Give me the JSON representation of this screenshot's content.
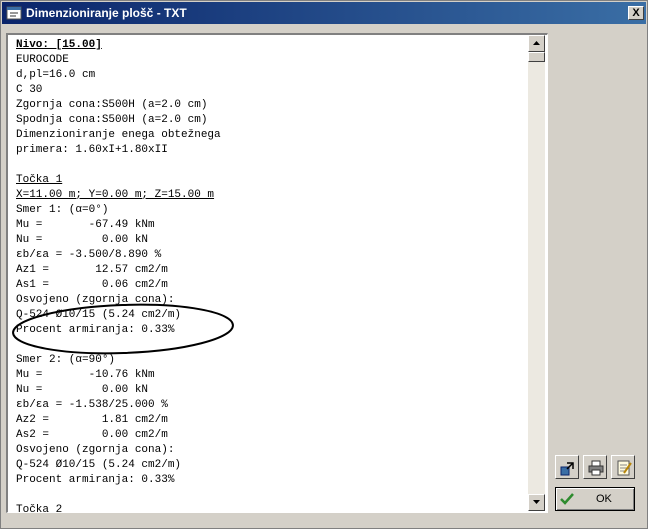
{
  "window": {
    "title": "Dimenzioniranje plošč - TXT",
    "close_label": "X"
  },
  "content_lines": [
    {
      "text": "Nivo: [15.00]",
      "style": "bu"
    },
    {
      "text": "EUROCODE"
    },
    {
      "text": "d,pl=16.0 cm"
    },
    {
      "text": "C 30"
    },
    {
      "text": "Zgornja cona:S500H (a=2.0 cm)"
    },
    {
      "text": "Spodnja cona:S500H (a=2.0 cm)"
    },
    {
      "text": "Dimenzioniranje enega obtežnega"
    },
    {
      "text": "primera: 1.60xI+1.80xII"
    },
    {
      "text": ""
    },
    {
      "text": "Točka 1",
      "style": "u"
    },
    {
      "text": "X=11.00 m; Y=0.00 m; Z=15.00 m",
      "style": "u"
    },
    {
      "text": "Smer 1: (α=0°)"
    },
    {
      "text": "Mu =       -67.49 kNm"
    },
    {
      "text": "Nu =         0.00 kN"
    },
    {
      "text": "εb/εa = -3.500/8.890 %"
    },
    {
      "text": "Az1 =       12.57 cm2/m"
    },
    {
      "text": "As1 =        0.06 cm2/m"
    },
    {
      "text": "Osvojeno (zgornja cona):"
    },
    {
      "text": "Q-524 Ø10/15 (5.24 cm2/m)"
    },
    {
      "text": "Procent armiranja: 0.33%"
    },
    {
      "text": ""
    },
    {
      "text": "Smer 2: (α=90°)"
    },
    {
      "text": "Mu =       -10.76 kNm"
    },
    {
      "text": "Nu =         0.00 kN"
    },
    {
      "text": "εb/εa = -1.538/25.000 %"
    },
    {
      "text": "Az2 =        1.81 cm2/m"
    },
    {
      "text": "As2 =        0.00 cm2/m"
    },
    {
      "text": "Osvojeno (zgornja cona):"
    },
    {
      "text": "Q-524 Ø10/15 (5.24 cm2/m)"
    },
    {
      "text": "Procent armiranja: 0.33%"
    },
    {
      "text": ""
    },
    {
      "text": "Točka 2",
      "style": "u"
    }
  ],
  "buttons": {
    "ok_label": "OK"
  },
  "icons": {
    "title": "app-window-icon",
    "tool1": "export-icon",
    "tool2": "printer-icon",
    "tool3": "notepad-icon",
    "ok": "checkmark-icon"
  },
  "colors": {
    "titlebar_start": "#0a246a",
    "titlebar_end": "#3a6ea5",
    "face": "#d4d0c8",
    "ok_check": "#2e8b2e"
  }
}
